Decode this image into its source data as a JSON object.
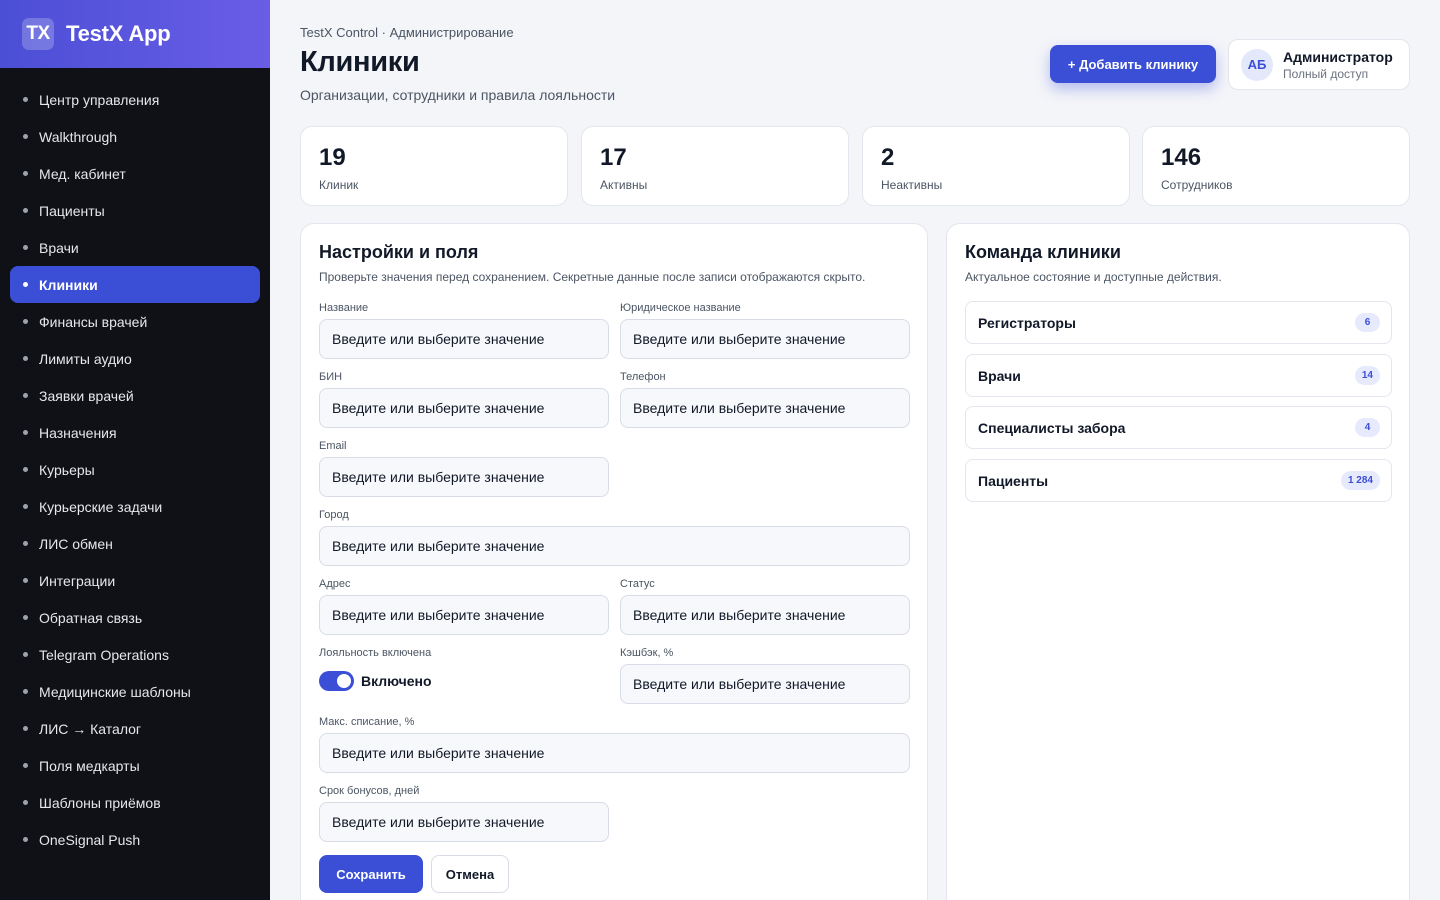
{
  "brand": {
    "logo": "TX",
    "name": "TestX App"
  },
  "sidebar": {
    "items": [
      {
        "label": "Центр управления"
      },
      {
        "label": "Walkthrough"
      },
      {
        "label": "Мед. кабинет"
      },
      {
        "label": "Пациенты"
      },
      {
        "label": "Врачи"
      },
      {
        "label": "Клиники",
        "active": true
      },
      {
        "label": "Финансы врачей"
      },
      {
        "label": "Лимиты аудио"
      },
      {
        "label": "Заявки врачей"
      },
      {
        "label": "Назначения"
      },
      {
        "label": "Курьеры"
      },
      {
        "label": "Курьерские задачи"
      },
      {
        "label": "ЛИС обмен"
      },
      {
        "label": "Интеграции"
      },
      {
        "label": "Обратная связь"
      },
      {
        "label": "Telegram Operations"
      },
      {
        "label": "Медицинские шаблоны"
      },
      {
        "label": "ЛИС → Каталог"
      },
      {
        "label": "Поля медкарты"
      },
      {
        "label": "Шаблоны приёмов"
      },
      {
        "label": "OneSignal Push"
      }
    ]
  },
  "header": {
    "breadcrumb": "TestX Control · Администрирование",
    "title": "Клиники",
    "subtitle": "Организации, сотрудники и правила лояльности",
    "add_button": "+ Добавить клинику",
    "user": {
      "initials": "АБ",
      "name": "Администратор",
      "role": "Полный доступ"
    }
  },
  "stats": [
    {
      "value": "19",
      "label": "Клиник"
    },
    {
      "value": "17",
      "label": "Активны"
    },
    {
      "value": "2",
      "label": "Неактивны"
    },
    {
      "value": "146",
      "label": "Сотрудников"
    }
  ],
  "form": {
    "title": "Настройки и поля",
    "description": "Проверьте значения перед сохранением. Секретные данные после записи отображаются скрыто.",
    "placeholder": "Введите или выберите значение",
    "labels": {
      "name": "Название",
      "legal_name": "Юридическое название",
      "bin": "БИН",
      "phone": "Телефон",
      "email": "Email",
      "city": "Город",
      "address": "Адрес",
      "status": "Статус",
      "loyalty": "Лояльность включена",
      "cashback": "Кэшбэк, %",
      "max_writeoff": "Макс. списание, %",
      "bonus_term": "Срок бонусов, дней"
    },
    "loyalty_state": "Включено",
    "save_label": "Сохранить",
    "cancel_label": "Отмена"
  },
  "team": {
    "title": "Команда клиники",
    "description": "Актуальное состояние и доступные действия.",
    "rows": [
      {
        "label": "Регистраторы",
        "count": "6"
      },
      {
        "label": "Врачи",
        "count": "14"
      },
      {
        "label": "Специалисты забора",
        "count": "4"
      },
      {
        "label": "Пациенты",
        "count": "1 284"
      }
    ]
  },
  "colors": {
    "accent": "#3b4fd6",
    "sidebar_bg": "#0f1117",
    "page_bg": "#f4f5f9"
  }
}
